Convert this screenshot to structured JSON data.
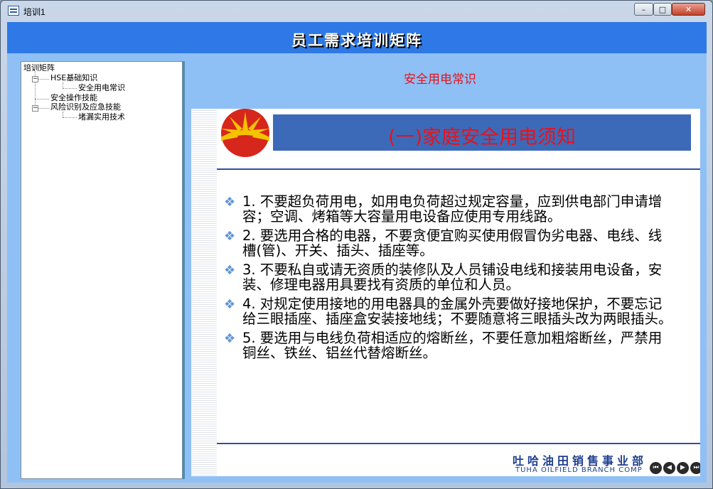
{
  "window": {
    "title": "培训1",
    "minimize": "–",
    "maximize": "□",
    "close": "✕"
  },
  "header": {
    "title": "员工需求培训矩阵"
  },
  "tree": {
    "root": "培训矩阵",
    "nodes": [
      {
        "label": "HSE基础知识",
        "expander": "−"
      },
      {
        "label": "安全用电常识"
      },
      {
        "label": "安全操作技能"
      },
      {
        "label": "风险识别及应急技能",
        "expander": "−"
      },
      {
        "label": "堵漏实用技术"
      }
    ]
  },
  "content": {
    "section_title": "安全用电常识",
    "slide": {
      "heading": "(一)家庭安全用电须知",
      "bullet_glyph": "❖",
      "items": [
        "1.  不要超负荷用电，如用电负荷超过规定容量，应到供电部门申请增容；空调、烤箱等大容量用电设备应使用专用线路。",
        "2.  要选用合格的电器，不要贪便宜购买使用假冒伪劣电器、电线、线槽(管)、开关、插头、插座等。",
        "3.  不要私自或请无资质的装修队及人员铺设电线和接装用电设备，安装、修理电器用具要找有资质的单位和人员。",
        "4.  对规定使用接地的用电器具的金属外壳要做好接地保护，不要忘记给三眼插座、插座盒安装接地线；不要随意将三眼插头改为两眼插头。",
        "5.  要选用与电线负荷相适应的熔断丝，不要任意加粗熔断丝，严禁用铜丝、铁丝、铝丝代替熔断丝。"
      ],
      "footer_cn": "吐哈油田销售事业部",
      "footer_en": "TUHA OILFIELD BRANCH COMP",
      "nav": {
        "first": "⏮",
        "prev": "◀",
        "next": "▶",
        "last": "⏭"
      }
    }
  },
  "colors": {
    "header_bg": "#2e79e6",
    "client_bg": "#8fc0f5",
    "accent_red": "#e8111b",
    "banner_blue": "#3c6ab8"
  }
}
